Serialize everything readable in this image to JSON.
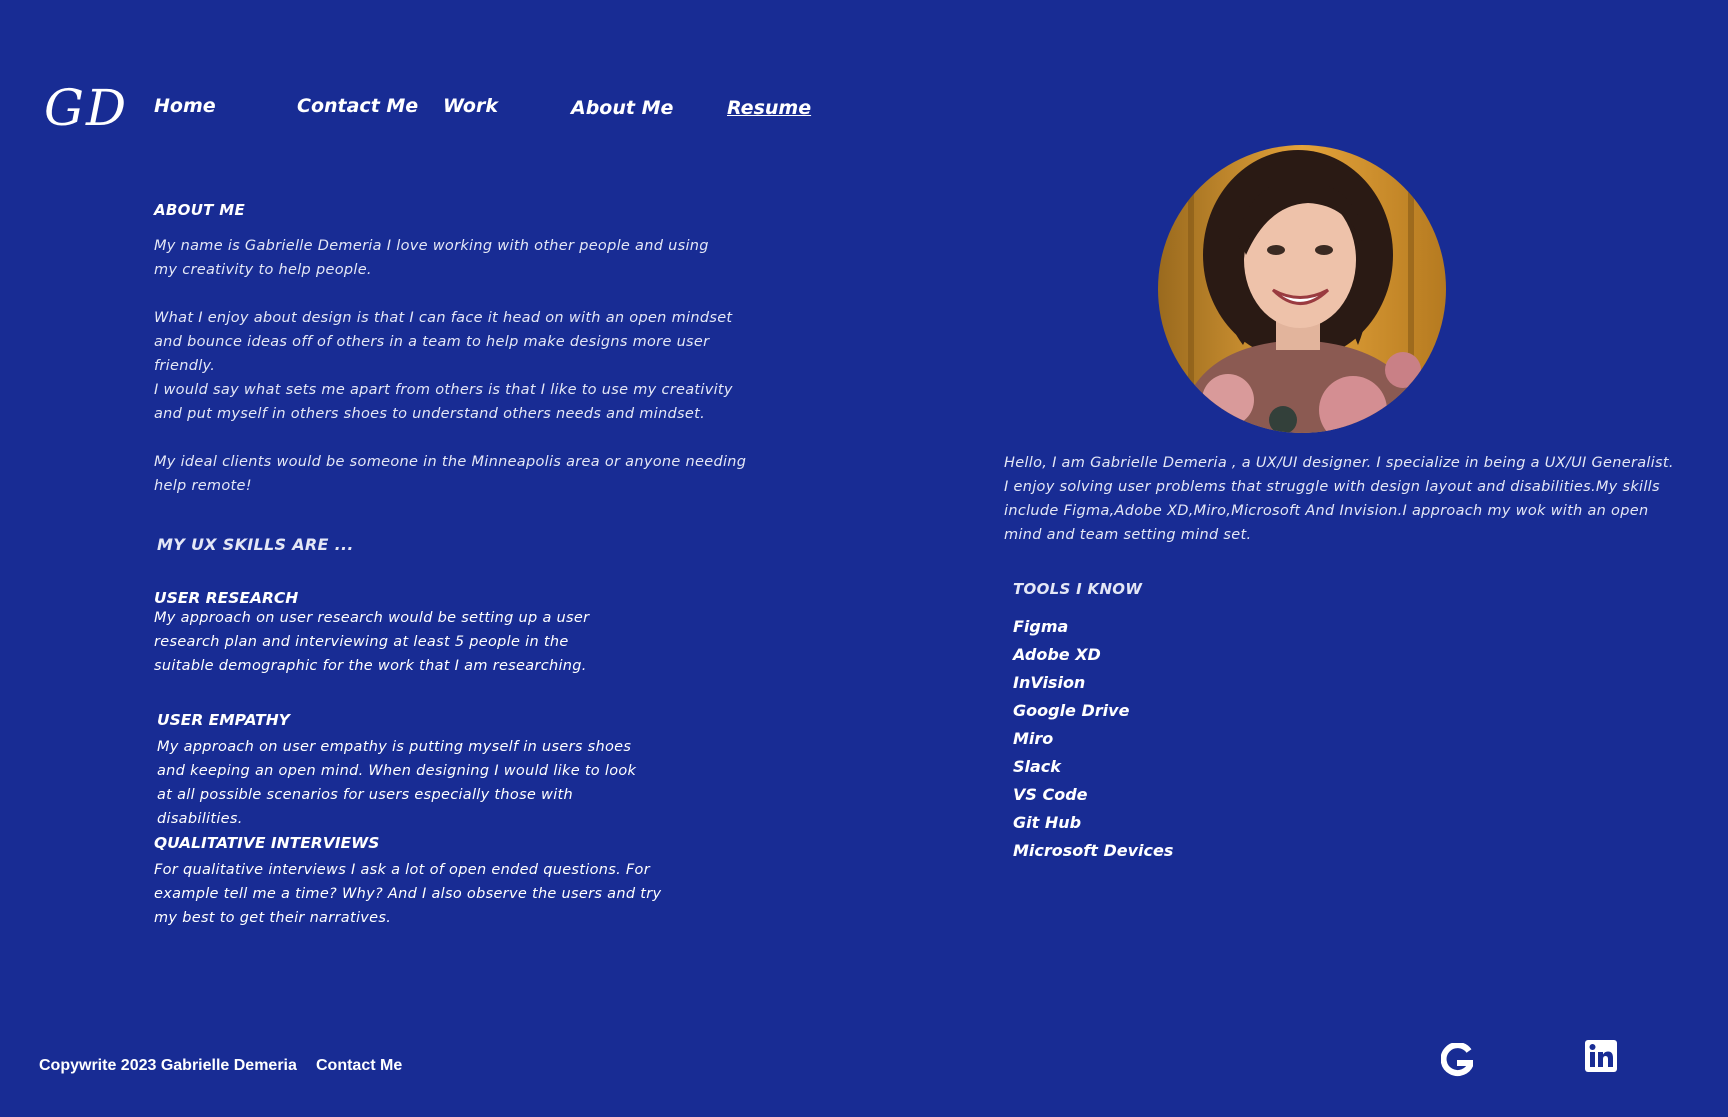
{
  "header": {
    "logo": "GD",
    "nav": {
      "home": "Home",
      "contact": "Contact Me",
      "work": "Work",
      "about": "About Me",
      "resume": "Resume"
    }
  },
  "about": {
    "title": "ABOUT ME",
    "paragraphs": [
      "My name is Gabrielle Demeria I love working with other people and using my creativity to help people.",
      "What I enjoy about design is that I can face it head on with an open mindset and bounce ideas off of others in a team to help make designs more user friendly.",
      "I would say what sets me apart from others is that I like to use my creativity and put myself in others shoes to understand others needs and mindset.",
      "My ideal clients would be someone in the Minneapolis area or anyone needing help remote!"
    ]
  },
  "skills": {
    "heading": "MY UX SKILLS ARE ...",
    "items": [
      {
        "title": "USER RESEARCH",
        "text": "My approach on user research would be setting up a user research plan and interviewing at least 5 people in the suitable demographic for the work that I am researching."
      },
      {
        "title": "USER EMPATHY",
        "text": "My approach on user empathy is putting myself in users shoes and keeping an open mind. When designing I would like to look at all possible scenarios for users especially those with disabilities."
      },
      {
        "title": "QUALITATIVE INTERVIEWS",
        "text": "For qualitative interviews I ask a lot of open ended questions. For example tell me a time? Why? And I also observe the users and try my best to get their narratives."
      }
    ]
  },
  "intro": {
    "text": "Hello, I am Gabrielle Demeria , a UX/UI designer. I specialize in being a UX/UI Generalist. I enjoy solving user problems that struggle with design layout and disabilities.My skills include Figma,Adobe XD,Miro,Microsoft And Invision.I approach my wok with an open mind and team setting mind set."
  },
  "tools": {
    "title": "TOOLS I KNOW",
    "items": [
      "Figma",
      "Adobe XD",
      "InVision",
      "Google Drive",
      "Miro",
      "Slack",
      "VS Code",
      "Git Hub",
      "Microsoft Devices"
    ]
  },
  "footer": {
    "copyright": "Copywrite 2023 Gabrielle Demeria",
    "contact": "Contact Me",
    "social": [
      "google-icon",
      "linkedin-icon"
    ]
  },
  "colors": {
    "background": "#182c94",
    "text": "#ffffff"
  }
}
